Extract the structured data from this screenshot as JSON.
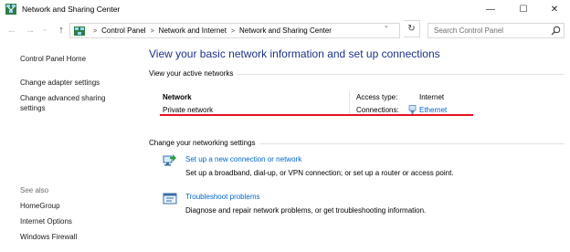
{
  "window": {
    "title": "Network and Sharing Center",
    "controls": {
      "minimize": "—",
      "maximize": "☐",
      "close": "✕"
    }
  },
  "navigation": {
    "back_icon": "back-arrow",
    "forward_icon": "forward-arrow",
    "up_icon": "up-arrow",
    "breadcrumbs": [
      "Control Panel",
      "Network and Internet",
      "Network and Sharing Center"
    ],
    "search_placeholder": "Search Control Panel"
  },
  "sidebar": {
    "links": [
      "Control Panel Home",
      "Change adapter settings",
      "Change advanced sharing",
      "settings"
    ],
    "see_also_label": "See also",
    "see_also_links": [
      "HomeGroup",
      "Internet Options",
      "Windows Firewall"
    ]
  },
  "main": {
    "title": "View your basic network information and set up connections",
    "active_networks_label": "View your active networks",
    "network": {
      "name": "Network",
      "type": "Private network",
      "access_type_label": "Access type:",
      "access_type_value": "Internet",
      "connections_label": "Connections:",
      "connections_value": "Ethernet"
    },
    "settings_label": "Change your networking settings",
    "tasks": [
      {
        "link": "Set up a new connection or network",
        "description": "Set up a broadband, dial-up, or VPN connection; or set up a router or access point."
      },
      {
        "link": "Troubleshoot problems",
        "description": "Diagnose and repair network problems, or get troubleshooting information."
      }
    ]
  },
  "colors": {
    "title_blue": "#1e3287",
    "link_blue": "#0066cc",
    "annotation_red": "#e81123"
  }
}
